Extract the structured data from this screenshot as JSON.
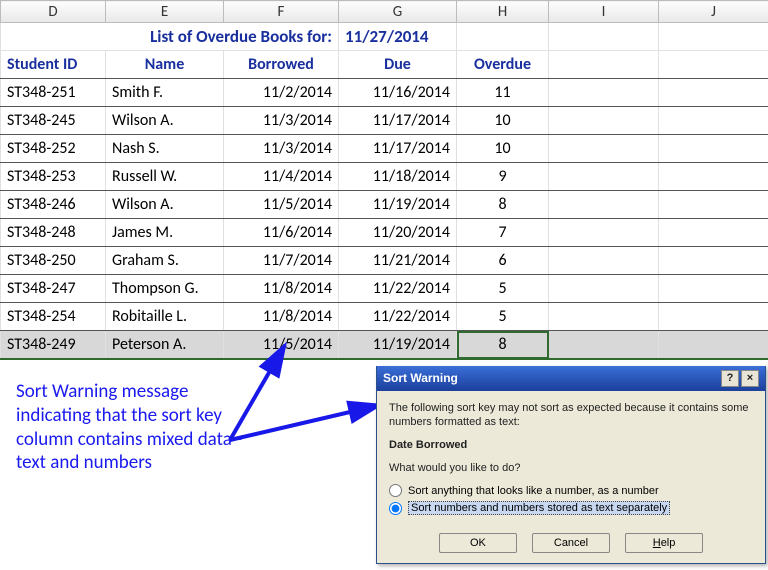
{
  "columns": [
    "D",
    "E",
    "F",
    "G",
    "H",
    "I",
    "J"
  ],
  "title": {
    "label": "List of Overdue Books for:",
    "date": "11/27/2014"
  },
  "headers": {
    "id": "Student ID",
    "name": "Name",
    "borrowed": "Borrowed",
    "due": "Due",
    "overdue": "Overdue"
  },
  "rows": [
    {
      "id": "ST348-251",
      "name": "Smith F.",
      "borrowed": "11/2/2014",
      "due": "11/16/2014",
      "overdue": "11"
    },
    {
      "id": "ST348-245",
      "name": "Wilson A.",
      "borrowed": "11/3/2014",
      "due": "11/17/2014",
      "overdue": "10"
    },
    {
      "id": "ST348-252",
      "name": "Nash S.",
      "borrowed": "11/3/2014",
      "due": "11/17/2014",
      "overdue": "10"
    },
    {
      "id": "ST348-253",
      "name": "Russell W.",
      "borrowed": "11/4/2014",
      "due": "11/18/2014",
      "overdue": "9"
    },
    {
      "id": "ST348-246",
      "name": "Wilson A.",
      "borrowed": "11/5/2014",
      "due": "11/19/2014",
      "overdue": "8"
    },
    {
      "id": "ST348-248",
      "name": "James M.",
      "borrowed": "11/6/2014",
      "due": "11/20/2014",
      "overdue": "7"
    },
    {
      "id": "ST348-250",
      "name": "Graham S.",
      "borrowed": "11/7/2014",
      "due": "11/21/2014",
      "overdue": "6"
    },
    {
      "id": "ST348-247",
      "name": "Thompson G.",
      "borrowed": "11/8/2014",
      "due": "11/22/2014",
      "overdue": "5"
    },
    {
      "id": "ST348-254",
      "name": "Robitaille L.",
      "borrowed": "11/8/2014",
      "due": "11/22/2014",
      "overdue": "5"
    },
    {
      "id": "ST348-249",
      "name": "Peterson A.",
      "borrowed": "11/5/2014",
      "due": "11/19/2014",
      "overdue": "8"
    }
  ],
  "annotation": "Sort Warning message indicating that the sort key column contains mixed data - text and numbers",
  "dialog": {
    "title": "Sort Warning",
    "msg": "The following sort key may not sort as expected because it contains some numbers formatted as text:",
    "key": "Date Borrowed",
    "prompt": "What would you like to do?",
    "opt1": "Sort anything that looks like a number, as a number",
    "opt2": "Sort numbers and numbers stored as text separately",
    "ok": "OK",
    "cancel": "Cancel",
    "help": "Help",
    "help_icon": "?",
    "close_icon": "×"
  }
}
